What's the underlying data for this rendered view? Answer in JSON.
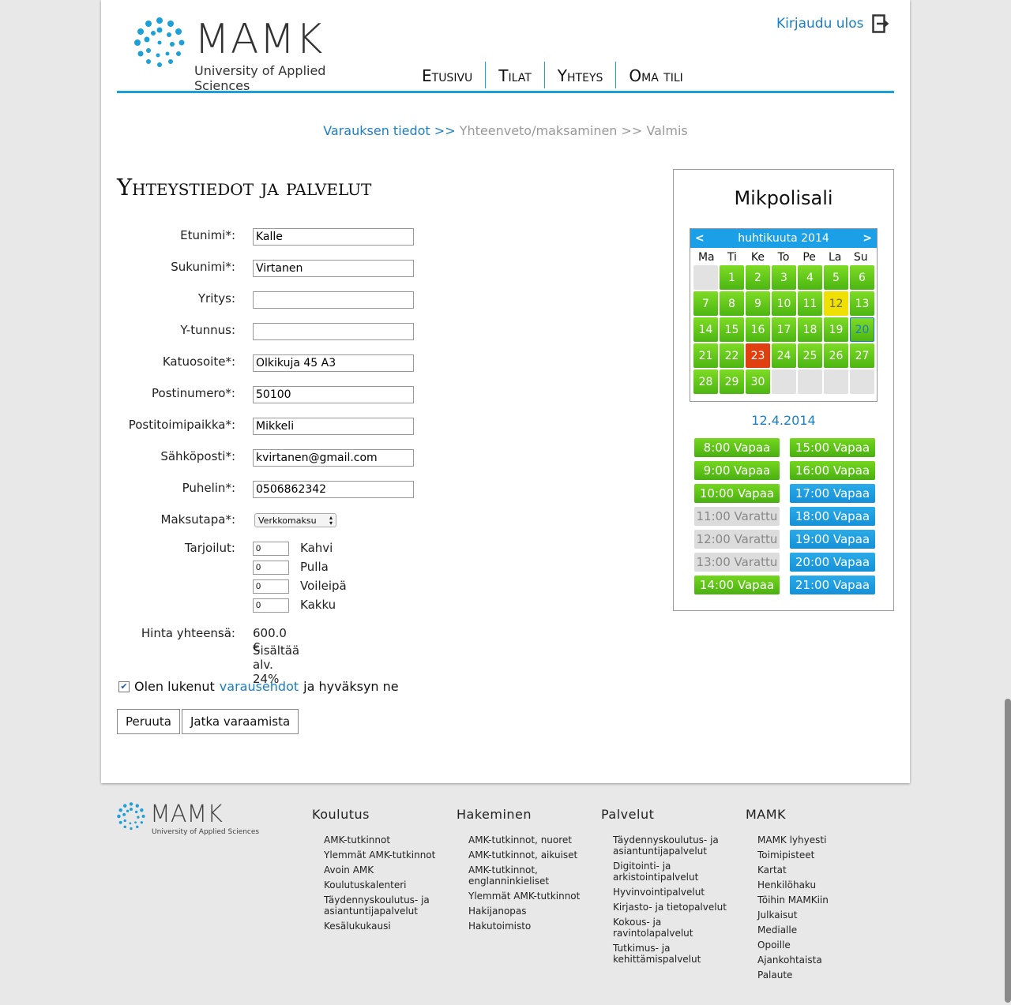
{
  "header": {
    "logo_text": "MAMK",
    "logo_subtitle": "University of Applied Sciences",
    "logout_label": "Kirjaudu ulos",
    "nav": [
      {
        "label": "Etusivu"
      },
      {
        "label": "Tilat"
      },
      {
        "label": "Yhteys"
      },
      {
        "label": "Oma tili"
      }
    ]
  },
  "breadcrumb": {
    "step1": "Varauksen tiedot >>",
    "step2": "Yhteenveto/maksaminen >>",
    "step3": "Valmis"
  },
  "form": {
    "title": "Yhteystiedot ja palvelut",
    "fields": [
      {
        "label": "Etunimi*:",
        "value": "Kalle"
      },
      {
        "label": "Sukunimi*:",
        "value": "Virtanen"
      },
      {
        "label": "Yritys:",
        "value": ""
      },
      {
        "label": "Y-tunnus:",
        "value": ""
      },
      {
        "label": "Katuosoite*:",
        "value": "Olkikuja 45 A3"
      },
      {
        "label": "Postinumero*:",
        "value": "50100"
      },
      {
        "label": "Postitoimipaikka*:",
        "value": "Mikkeli"
      },
      {
        "label": "Sähköposti*:",
        "value": "kvirtanen@gmail.com"
      },
      {
        "label": "Puhelin*:",
        "value": "0506862342"
      }
    ],
    "payment_label": "Maksutapa*:",
    "payment_value": "Verkkomaksu",
    "refreshments_label": "Tarjoilut:",
    "refreshments": [
      {
        "qty": "0",
        "name": "Kahvi"
      },
      {
        "qty": "0",
        "name": "Pulla"
      },
      {
        "qty": "0",
        "name": "Voileipä"
      },
      {
        "qty": "0",
        "name": "Kakku"
      }
    ],
    "price_label": "Hinta yhteensä:",
    "price_value": "600.0 €",
    "vat_text": "Sisältää alv. 24%",
    "terms_before": "Olen lukenut",
    "terms_link": "varausehdot",
    "terms_after": "ja hyväksyn ne",
    "terms_checked": true,
    "cancel_label": "Peruuta",
    "continue_label": "Jatka varaamista"
  },
  "sidebar": {
    "venue": "Mikpolisali",
    "calendar": {
      "prev": "<",
      "next": ">",
      "month": "huhtikuuta 2014",
      "weekdays": [
        "Ma",
        "Ti",
        "Ke",
        "To",
        "Pe",
        "La",
        "Su"
      ],
      "days": [
        {
          "n": "",
          "s": "e"
        },
        {
          "n": "1",
          "s": "g"
        },
        {
          "n": "2",
          "s": "g"
        },
        {
          "n": "3",
          "s": "g"
        },
        {
          "n": "4",
          "s": "g"
        },
        {
          "n": "5",
          "s": "g"
        },
        {
          "n": "6",
          "s": "g"
        },
        {
          "n": "7",
          "s": "g"
        },
        {
          "n": "8",
          "s": "g"
        },
        {
          "n": "9",
          "s": "g"
        },
        {
          "n": "10",
          "s": "g"
        },
        {
          "n": "11",
          "s": "g"
        },
        {
          "n": "12",
          "s": "y"
        },
        {
          "n": "13",
          "s": "g"
        },
        {
          "n": "14",
          "s": "g"
        },
        {
          "n": "15",
          "s": "g"
        },
        {
          "n": "16",
          "s": "g"
        },
        {
          "n": "17",
          "s": "g"
        },
        {
          "n": "18",
          "s": "g"
        },
        {
          "n": "19",
          "s": "g"
        },
        {
          "n": "20",
          "s": "sel"
        },
        {
          "n": "21",
          "s": "g"
        },
        {
          "n": "22",
          "s": "g"
        },
        {
          "n": "23",
          "s": "r"
        },
        {
          "n": "24",
          "s": "g"
        },
        {
          "n": "25",
          "s": "g"
        },
        {
          "n": "26",
          "s": "g"
        },
        {
          "n": "27",
          "s": "g"
        },
        {
          "n": "28",
          "s": "g"
        },
        {
          "n": "29",
          "s": "g"
        },
        {
          "n": "30",
          "s": "g"
        },
        {
          "n": "",
          "s": "e"
        },
        {
          "n": "",
          "s": "e"
        },
        {
          "n": "",
          "s": "e"
        },
        {
          "n": "",
          "s": "e"
        }
      ]
    },
    "selected_date": "12.4.2014",
    "slots": [
      {
        "label": "8:00 Vapaa",
        "s": "g"
      },
      {
        "label": "15:00 Vapaa",
        "s": "g"
      },
      {
        "label": "9:00 Vapaa",
        "s": "g"
      },
      {
        "label": "16:00 Vapaa",
        "s": "g"
      },
      {
        "label": "10:00 Vapaa",
        "s": "g"
      },
      {
        "label": "17:00 Vapaa",
        "s": "b"
      },
      {
        "label": "11:00 Varattu",
        "s": "x"
      },
      {
        "label": "18:00 Vapaa",
        "s": "b"
      },
      {
        "label": "12:00 Varattu",
        "s": "x"
      },
      {
        "label": "19:00 Vapaa",
        "s": "b"
      },
      {
        "label": "13:00 Varattu",
        "s": "x"
      },
      {
        "label": "20:00 Vapaa",
        "s": "b"
      },
      {
        "label": "14:00 Vapaa",
        "s": "g"
      },
      {
        "label": "21:00 Vapaa",
        "s": "b"
      }
    ]
  },
  "footer": {
    "logo_text": "MAMK",
    "logo_subtitle": "University of Applied Sciences",
    "columns": [
      {
        "title": "Koulutus",
        "items": [
          "AMK-tutkinnot",
          "Ylemmät AMK-tutkinnot",
          "Avoin AMK",
          "Koulutuskalenteri",
          "Täydennyskoulutus- ja asiantuntijapalvelut",
          "Kesälukukausi"
        ]
      },
      {
        "title": "Hakeminen",
        "items": [
          "AMK-tutkinnot, nuoret",
          "AMK-tutkinnot, aikuiset",
          "AMK-tutkinnot, englanninkieliset",
          "Ylemmät AMK-tutkinnot",
          "Hakijanopas",
          "Hakutoimisto"
        ]
      },
      {
        "title": "Palvelut",
        "items": [
          "Täydennyskoulutus- ja asiantuntijapalvelut",
          "Digitointi- ja arkistointipalvelut",
          "Hyvinvointipalvelut",
          "Kirjasto- ja tietopalvelut",
          "Kokous- ja ravintolapalvelut",
          "Tutkimus- ja kehittämispalvelut"
        ]
      },
      {
        "title": "MAMK",
        "items": [
          "MAMK lyhyesti",
          "Toimipisteet",
          "Kartat",
          "Henkilöhaku",
          "Töihin MAMKiin",
          "Julkaisut",
          "Medialle",
          "Opoille",
          "Ajankohtaista",
          "Palaute"
        ]
      }
    ]
  },
  "colors": {
    "accent": "#1ba0d8",
    "link": "#1a7fc4",
    "free_green": "#5cc417",
    "free_blue": "#1ba0e8",
    "reserved_gray": "#dcdcdc",
    "day_yellow": "#f0e000",
    "day_red": "#e04010"
  }
}
